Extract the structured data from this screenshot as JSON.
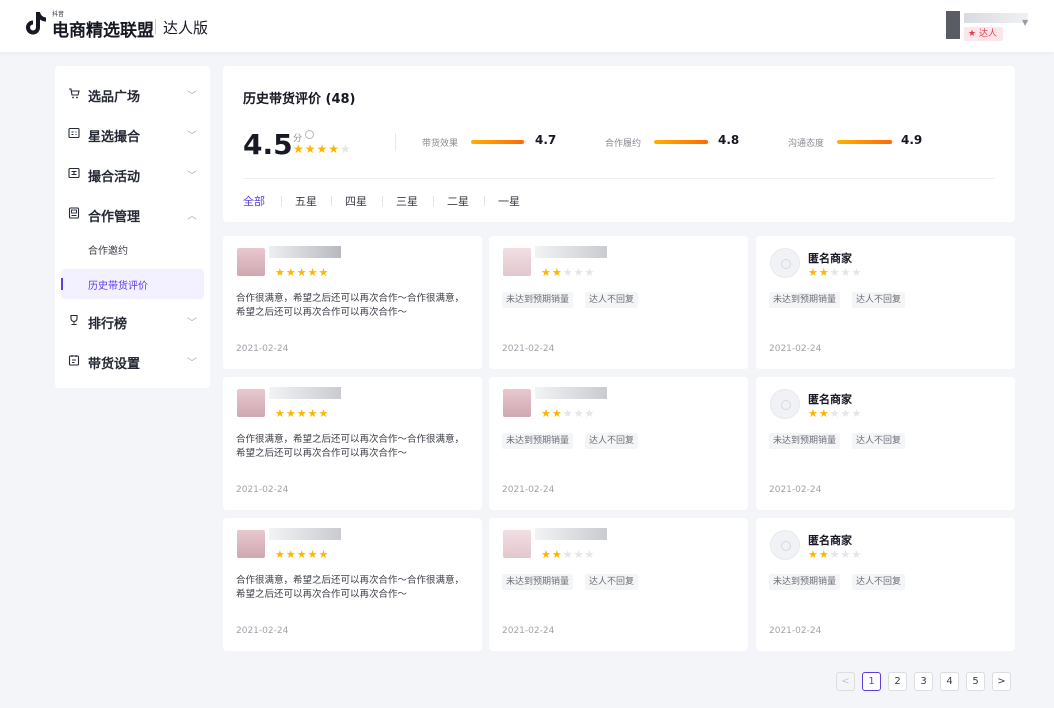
{
  "header": {
    "logo_sub": "抖音",
    "brand": "电商精选联盟",
    "version": "达人版",
    "user_badge": "达人"
  },
  "sidebar": {
    "items": [
      {
        "label": "选品广场",
        "icon": "shop-icon"
      },
      {
        "label": "星选撮合",
        "icon": "match-icon"
      },
      {
        "label": "撮合活动",
        "icon": "activity-icon"
      },
      {
        "label": "合作管理",
        "icon": "cooperation-icon",
        "expanded": true
      },
      {
        "label": "排行榜",
        "icon": "trophy-icon"
      },
      {
        "label": "带货设置",
        "icon": "settings-icon"
      }
    ],
    "sub_items": [
      {
        "label": "合作邀约"
      },
      {
        "label": "历史带货评价",
        "active": true
      }
    ]
  },
  "summary": {
    "title": "历史带货评价 (48)",
    "score": "4.5",
    "score_unit": "分",
    "score_stars": 4.5,
    "metrics": [
      {
        "label": "带货效果",
        "value": "4.7",
        "score": 4.7
      },
      {
        "label": "合作履约",
        "value": "4.8",
        "score": 4.8
      },
      {
        "label": "沟通态度",
        "value": "4.9",
        "score": 4.9
      }
    ],
    "tabs": [
      "全部",
      "五星",
      "四星",
      "三星",
      "二星",
      "一星"
    ],
    "active_tab": 0
  },
  "reviews": {
    "comment": "合作很满意，希望之后还可以再次合作～合作很满意，希望之后还可以再次合作可以再次合作～",
    "anon_name": "匿名商家",
    "tags": [
      "未达到预期销量",
      "达人不回复"
    ],
    "date": "2021-02-24"
  },
  "pagination": {
    "pages": [
      "1",
      "2",
      "3",
      "4",
      "5"
    ],
    "current": 1,
    "prev": "<",
    "next": ">"
  },
  "colors": {
    "accent": "#5e3ce0",
    "star": "#ffb400",
    "bar_start": "#ffb000",
    "bar_end": "#ff6a00"
  }
}
